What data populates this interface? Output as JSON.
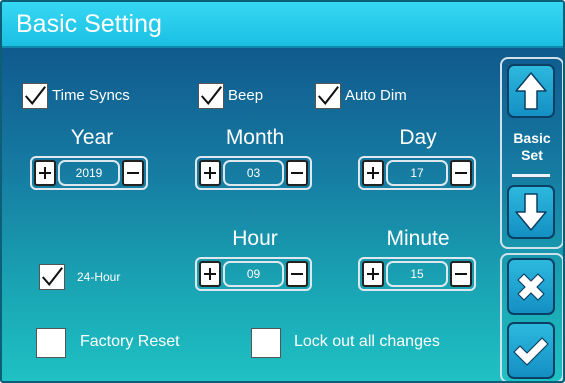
{
  "title": "Basic Setting",
  "checkboxes": {
    "time_syncs": {
      "label": "Time Syncs",
      "checked": true
    },
    "beep": {
      "label": "Beep",
      "checked": true
    },
    "auto_dim": {
      "label": "Auto Dim",
      "checked": true
    },
    "hour24": {
      "label": "24-Hour",
      "checked": true
    },
    "factory_reset": {
      "label": "Factory Reset",
      "checked": false
    },
    "lock_out": {
      "label": "Lock out all changes",
      "checked": false
    }
  },
  "fields": {
    "year": {
      "label": "Year",
      "value": "2019"
    },
    "month": {
      "label": "Month",
      "value": "03"
    },
    "day": {
      "label": "Day",
      "value": "17"
    },
    "hour": {
      "label": "Hour",
      "value": "09"
    },
    "minute": {
      "label": "Minute",
      "value": "15"
    }
  },
  "sidebar": {
    "label_line1": "Basic",
    "label_line2": "Set",
    "up_icon": "arrow-up-icon",
    "down_icon": "arrow-down-icon",
    "cancel_icon": "close-icon",
    "confirm_icon": "checkmark-icon"
  },
  "colors": {
    "title_bar": "#1bbfe2",
    "background_top": "#0e4d86",
    "background_bottom": "#1fc1c4",
    "side_button": "#1490c3"
  }
}
